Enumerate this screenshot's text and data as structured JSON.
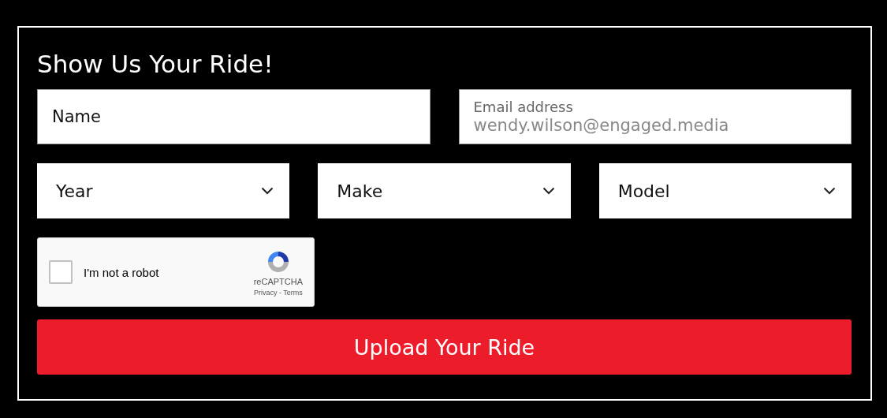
{
  "title": "Show Us Your Ride!",
  "fields": [
    {
      "kind": "text",
      "placeholder": "Name"
    },
    {
      "kind": "floating",
      "label": "Email address",
      "placeholder": "wendy.wilson@engaged.media"
    }
  ],
  "selects": [
    {
      "label": "Year"
    },
    {
      "label": "Make"
    },
    {
      "label": "Model"
    }
  ],
  "captcha": {
    "label": "I'm not a robot",
    "checked": false,
    "brand": "reCAPTCHA",
    "links": "Privacy - Terms"
  },
  "submit": "Upload Your Ride"
}
